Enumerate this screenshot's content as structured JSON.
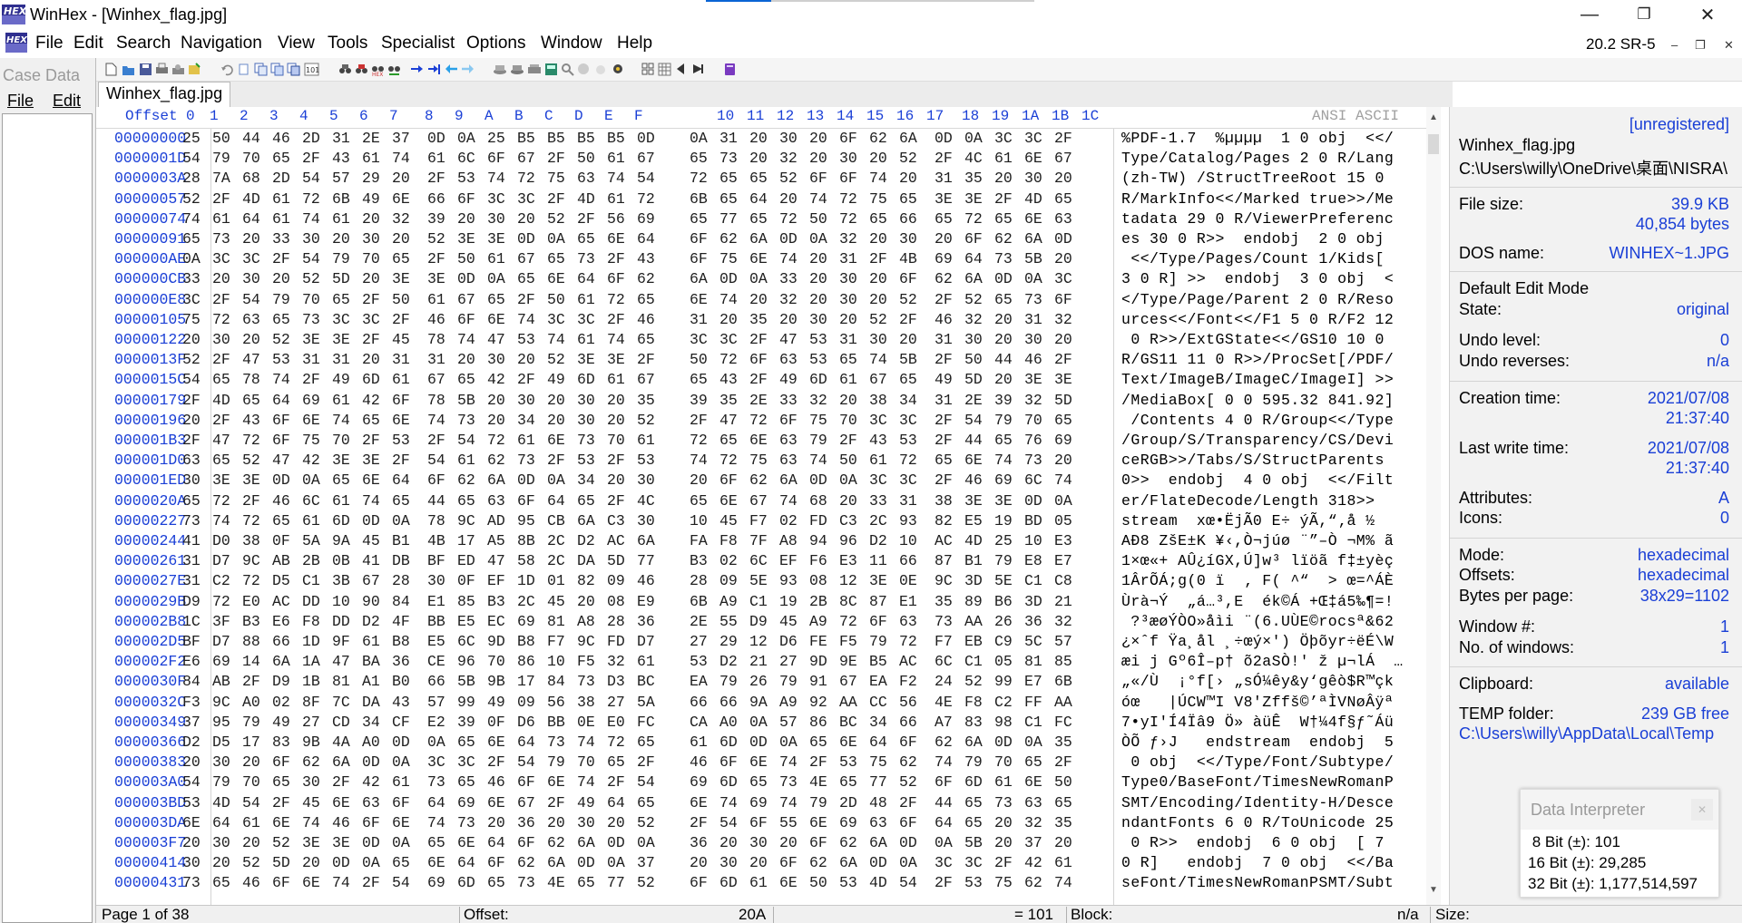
{
  "window": {
    "title": "WinHex - [Winhex_flag.jpg]",
    "logo": "HEX",
    "version": "20.2 SR-5",
    "minimize_icon": "minimize-icon",
    "restore_icon": "restore-icon",
    "close_icon": "close-icon"
  },
  "menu": [
    "File",
    "Edit",
    "Search",
    "Navigation",
    "View",
    "Tools",
    "Specialist",
    "Options",
    "Window",
    "Help"
  ],
  "case_data": {
    "title": "Case Data",
    "menu": [
      "File",
      "Edit"
    ]
  },
  "toolbar_icons": [
    "new-file-icon",
    "open-icon",
    "save-icon",
    "print-icon",
    "properties-icon",
    "undo-icon",
    "cut-icon",
    "copy-icon",
    "paste-icon",
    "paste-special-icon",
    "copy-hex-icon",
    "find-icon",
    "find-hex-icon",
    "find-next-icon",
    "replace-icon",
    "goto-offset-icon",
    "goto-icon",
    "back-icon",
    "forward-icon",
    "open-disk-icon",
    "disk-tools-icon",
    "ram-icon",
    "calculator-icon",
    "hash-icon",
    "analysis-icon",
    "grid-icon",
    "table-icon",
    "marker-icon",
    "jump-icon",
    "book-icon"
  ],
  "tab": "Winhex_flag.jpg",
  "hex_header": {
    "offset": "Offset",
    "columns": [
      "0",
      "1",
      "2",
      "3",
      "4",
      "5",
      "6",
      "7",
      "8",
      "9",
      "A",
      "B",
      "C",
      "D",
      "E",
      "F",
      "10",
      "11",
      "12",
      "13",
      "14",
      "15",
      "16",
      "17",
      "18",
      "19",
      "1A",
      "1B",
      "1C"
    ],
    "encoding": "ANSI ASCII"
  },
  "rows": [
    {
      "off": "00000000",
      "hex": "25 50 44 46 2D 31 2E 37 0D 0A 25 B5 B5 B5 B5 0D 0A 31 20 30 20 6F 62 6A 0D 0A 3C 3C 2F",
      "ascii": "%PDF-1.7  %µµµµ  1 0 obj  <</"
    },
    {
      "off": "0000001D",
      "hex": "54 79 70 65 2F 43 61 74 61 6C 6F 67 2F 50 61 67 65 73 20 32 20 30 20 52 2F 4C 61 6E 67",
      "ascii": "Type/Catalog/Pages 2 0 R/Lang"
    },
    {
      "off": "0000003A",
      "hex": "28 7A 68 2D 54 57 29 20 2F 53 74 72 75 63 74 54 72 65 65 52 6F 6F 74 20 31 35 20 30 20",
      "ascii": "(zh-TW) /StructTreeRoot 15 0 "
    },
    {
      "off": "00000057",
      "hex": "52 2F 4D 61 72 6B 49 6E 66 6F 3C 3C 2F 4D 61 72 6B 65 64 20 74 72 75 65 3E 3E 2F 4D 65",
      "ascii": "R/MarkInfo<</Marked true>>/Me"
    },
    {
      "off": "00000074",
      "hex": "74 61 64 61 74 61 20 32 39 20 30 20 52 2F 56 69 65 77 65 72 50 72 65 66 65 72 65 6E 63",
      "ascii": "tadata 29 0 R/ViewerPreferenc"
    },
    {
      "off": "00000091",
      "hex": "65 73 20 33 30 20 30 20 52 3E 3E 0D 0A 65 6E 64 6F 62 6A 0D 0A 32 20 30 20 6F 62 6A 0D",
      "ascii": "es 30 0 R>>  endobj  2 0 obj "
    },
    {
      "off": "000000AE",
      "hex": "0A 3C 3C 2F 54 79 70 65 2F 50 61 67 65 73 2F 43 6F 75 6E 74 20 31 2F 4B 69 64 73 5B 20",
      "ascii": " <</Type/Pages/Count 1/Kids[ "
    },
    {
      "off": "000000CB",
      "hex": "33 20 30 20 52 5D 20 3E 3E 0D 0A 65 6E 64 6F 62 6A 0D 0A 33 20 30 20 6F 62 6A 0D 0A 3C",
      "ascii": "3 0 R] >>  endobj  3 0 obj  <"
    },
    {
      "off": "000000E8",
      "hex": "3C 2F 54 79 70 65 2F 50 61 67 65 2F 50 61 72 65 6E 74 20 32 20 30 20 52 2F 52 65 73 6F",
      "ascii": "</Type/Page/Parent 2 0 R/Reso"
    },
    {
      "off": "00000105",
      "hex": "75 72 63 65 73 3C 3C 2F 46 6F 6E 74 3C 3C 2F 46 31 20 35 20 30 20 52 2F 46 32 20 31 32",
      "ascii": "urces<</Font<</F1 5 0 R/F2 12"
    },
    {
      "off": "00000122",
      "hex": "20 30 20 52 3E 3E 2F 45 78 74 47 53 74 61 74 65 3C 3C 2F 47 53 31 30 20 31 30 20 30 20",
      "ascii": " 0 R>>/ExtGState<</GS10 10 0 "
    },
    {
      "off": "0000013F",
      "hex": "52 2F 47 53 31 31 20 31 31 20 30 20 52 3E 3E 2F 50 72 6F 63 53 65 74 5B 2F 50 44 46 2F",
      "ascii": "R/GS11 11 0 R>>/ProcSet[/PDF/"
    },
    {
      "off": "0000015C",
      "hex": "54 65 78 74 2F 49 6D 61 67 65 42 2F 49 6D 61 67 65 43 2F 49 6D 61 67 65 49 5D 20 3E 3E",
      "ascii": "Text/ImageB/ImageC/ImageI] >>"
    },
    {
      "off": "00000179",
      "hex": "2F 4D 65 64 69 61 42 6F 78 5B 20 30 20 30 20 35 39 35 2E 33 32 20 38 34 31 2E 39 32 5D",
      "ascii": "/MediaBox[ 0 0 595.32 841.92]"
    },
    {
      "off": "00000196",
      "hex": "20 2F 43 6F 6E 74 65 6E 74 73 20 34 20 30 20 52 2F 47 72 6F 75 70 3C 3C 2F 54 79 70 65",
      "ascii": " /Contents 4 0 R/Group<</Type"
    },
    {
      "off": "000001B3",
      "hex": "2F 47 72 6F 75 70 2F 53 2F 54 72 61 6E 73 70 61 72 65 6E 63 79 2F 43 53 2F 44 65 76 69",
      "ascii": "/Group/S/Transparency/CS/Devi"
    },
    {
      "off": "000001D0",
      "hex": "63 65 52 47 42 3E 3E 2F 54 61 62 73 2F 53 2F 53 74 72 75 63 74 50 61 72 65 6E 74 73 20",
      "ascii": "ceRGB>>/Tabs/S/StructParents "
    },
    {
      "off": "000001ED",
      "hex": "30 3E 3E 0D 0A 65 6E 64 6F 62 6A 0D 0A 34 20 30 20 6F 62 6A 0D 0A 3C 3C 2F 46 69 6C 74",
      "ascii": "0>>  endobj  4 0 obj  <</Filt"
    },
    {
      "off": "0000020A",
      "hex": "65 72 2F 46 6C 61 74 65 44 65 63 6F 64 65 2F 4C 65 6E 67 74 68 20 33 31 38 3E 3E 0D 0A",
      "ascii": "er/FlateDecode/Length 318>>  "
    },
    {
      "off": "00000227",
      "hex": "73 74 72 65 61 6D 0D 0A 78 9C AD 95 CB 6A C3 30 10 45 F7 02 FD C3 2C 93 82 E5 19 BD 05",
      "ascii": "stream  xœ­•ËjÃ0 E÷ ýÃ,“‚å ½ "
    },
    {
      "off": "00000244",
      "hex": "41 D0 38 0F 5A 9A 45 B1 4B 17 A5 8B 2C D2 AC 6A FA F8 7F A8 94 96 D2 10 AC 4D 25 10 E3",
      "ascii": "AÐ8 ZšE±K ¥‹,Ò¬júø ¨”–Ò ¬M% ã"
    },
    {
      "off": "00000261",
      "hex": "31 D7 9C AB 2B 0B 41 DB BF ED 47 58 2C DA 5D 77 B3 02 6C EF F6 E3 11 66 87 B1 79 E8 E7",
      "ascii": "1×œ«+ AÛ¿íGX,Ú]w³ lïöã f‡±yèç"
    },
    {
      "off": "0000027E",
      "hex": "31 C2 72 D5 C1 3B 67 28 30 0F EF 1D 01 82 09 46 28 09 5E 93 08 12 3E 0E 9C 3D 5E C1 C8",
      "ascii": "1ÂrÕÁ;g(0 ï  ‚ F( ^“  > œ=^ÁÈ"
    },
    {
      "off": "0000029B",
      "hex": "D9 72 E0 AC DD 10 90 84 E1 85 B3 2C 45 20 08 E9 6B A9 C1 19 2B 8C 87 E1 35 89 B6 3D 21",
      "ascii": "Ùrà¬Ý  „á…³,E  ék©Á +Œ‡á5‰¶=!"
    },
    {
      "off": "000002B8",
      "hex": "1C 3F B3 E6 F8 DD D2 4F BB E5 EC 69 81 A8 28 36 2E 55 D9 45 A9 72 6F 63 73 AA 26 36 32",
      "ascii": " ?³æøÝÒO»åìi ¨(6.UÙE©rocsª&62"
    },
    {
      "off": "000002D5",
      "hex": "BF D7 88 66 1D 9F 61 B8 E5 6C 9D B8 F7 9C FD D7 27 29 12 D6 FE F5 79 72 F7 EB C9 5C 57",
      "ascii": "¿×ˆf Ÿa¸ål ¸÷œý×') Öþõyr÷ëÉ\\W"
    },
    {
      "off": "000002F2",
      "hex": "E6 69 14 6A 1A 47 BA 36 CE 96 70 86 10 F5 32 61 53 D2 21 27 9D 9E B5 AC 6C C1 05 81 85",
      "ascii": "æi j Gº6Î–p† õ2aSÒ!' ž µ¬lÁ  …"
    },
    {
      "off": "0000030F",
      "hex": "84 AB 2F D9 1B 81 A1 B0 66 5B 9B 17 84 73 D3 BC EA 79 26 79 91 67 EA F2 24 52 99 E7 6B",
      "ascii": "„«/Ù  ¡°f[› „sÓ¼êy&y‘gêò$R™çk"
    },
    {
      "off": "0000032C",
      "hex": "F3 9C A0 02 8F 7C DA 43 57 99 49 09 56 38 27 5A 66 66 9A A9 92 AA CC 56 4E F8 C2 FF AA",
      "ascii": "óœ   |ÚCW™I V8'Zffš©’ªÌVNøÂÿª"
    },
    {
      "off": "00000349",
      "hex": "37 95 79 49 27 CD 34 CF E2 39 0F D6 BB 0E E0 FC CA A0 0A 57 86 BC 34 66 A7 83 98 C1 FC",
      "ascii": "7•yI'Í4Ïâ9 Ö» àüÊ  W†¼4f§ƒ˜Áü"
    },
    {
      "off": "00000366",
      "hex": "D2 D5 17 83 9B 4A A0 0D 0A 65 6E 64 73 74 72 65 61 6D 0D 0A 65 6E 64 6F 62 6A 0D 0A 35",
      "ascii": "ÒÕ ƒ›J   endstream  endobj  5"
    },
    {
      "off": "00000383",
      "hex": "20 30 20 6F 62 6A 0D 0A 3C 3C 2F 54 79 70 65 2F 46 6F 6E 74 2F 53 75 62 74 79 70 65 2F",
      "ascii": " 0 obj  <</Type/Font/Subtype/"
    },
    {
      "off": "000003A0",
      "hex": "54 79 70 65 30 2F 42 61 73 65 46 6F 6E 74 2F 54 69 6D 65 73 4E 65 77 52 6F 6D 61 6E 50",
      "ascii": "Type0/BaseFont/TimesNewRomanP"
    },
    {
      "off": "000003BD",
      "hex": "53 4D 54 2F 45 6E 63 6F 64 69 6E 67 2F 49 64 65 6E 74 69 74 79 2D 48 2F 44 65 73 63 65",
      "ascii": "SMT/Encoding/Identity-H/Desce"
    },
    {
      "off": "000003DA",
      "hex": "6E 64 61 6E 74 46 6F 6E 74 73 20 36 20 30 20 52 2F 54 6F 55 6E 69 63 6F 64 65 20 32 35",
      "ascii": "ndantFonts 6 0 R/ToUnicode 25"
    },
    {
      "off": "000003F7",
      "hex": "20 30 20 52 3E 3E 0D 0A 65 6E 64 6F 62 6A 0D 0A 36 20 30 20 6F 62 6A 0D 0A 5B 20 37 20",
      "ascii": " 0 R>>  endobj  6 0 obj  [ 7 "
    },
    {
      "off": "00000414",
      "hex": "30 20 52 5D 20 0D 0A 65 6E 64 6F 62 6A 0D 0A 37 20 30 20 6F 62 6A 0D 0A 3C 3C 2F 42 61",
      "ascii": "0 R]   endobj  7 0 obj  <</Ba"
    },
    {
      "off": "00000431",
      "hex": "73 65 46 6F 6E 74 2F 54 69 6D 65 73 4E 65 77 52 6F 6D 61 6E 50 53 4D 54 2F 53 75 62 74",
      "ascii": "seFont/TimesNewRomanPSMT/Subt"
    }
  ],
  "info": {
    "unregistered": "[unregistered]",
    "filename": "Winhex_flag.jpg",
    "path": "C:\\Users\\willy\\OneDrive\\桌面\\NISRA\\",
    "file_size_label": "File size:",
    "file_size_kb": "39.9 KB",
    "file_size_bytes": "40,854 bytes",
    "dos_name_label": "DOS name:",
    "dos_name": "WINHEX~1.JPG",
    "edit_mode": "Default Edit Mode",
    "state_label": "State:",
    "state": "original",
    "undo_level_label": "Undo level:",
    "undo_level": "0",
    "undo_reverses_label": "Undo reverses:",
    "undo_reverses": "n/a",
    "creation_label": "Creation time:",
    "creation_date": "2021/07/08",
    "creation_time": "21:37:40",
    "lastwrite_label": "Last write time:",
    "lastwrite_date": "2021/07/08",
    "lastwrite_time": "21:37:40",
    "attributes_label": "Attributes:",
    "attributes": "A",
    "icons_label": "Icons:",
    "icons": "0",
    "mode_label": "Mode:",
    "mode": "hexadecimal",
    "offsets_label": "Offsets:",
    "offsets": "hexadecimal",
    "bpp_label": "Bytes per page:",
    "bpp": "38x29=1102",
    "window_no_label": "Window #:",
    "window_no": "1",
    "no_windows_label": "No. of windows:",
    "no_windows": "1",
    "clipboard_label": "Clipboard:",
    "clipboard": "available",
    "temp_label": "TEMP folder:",
    "temp_free": "239 GB free",
    "temp_path": "C:\\Users\\willy\\AppData\\Local\\Temp"
  },
  "interpreter": {
    "title": "Data Interpreter",
    "lines": [
      " 8 Bit (±): 101",
      "16 Bit (±): 29,285",
      "32 Bit (±): 1,177,514,597"
    ]
  },
  "status": {
    "page": "Page 1 of 38",
    "offset_label": "Offset:",
    "offset": "20A",
    "eq": "= 101",
    "block_label": "Block:",
    "block": "n/a",
    "size_label": "Size:"
  }
}
